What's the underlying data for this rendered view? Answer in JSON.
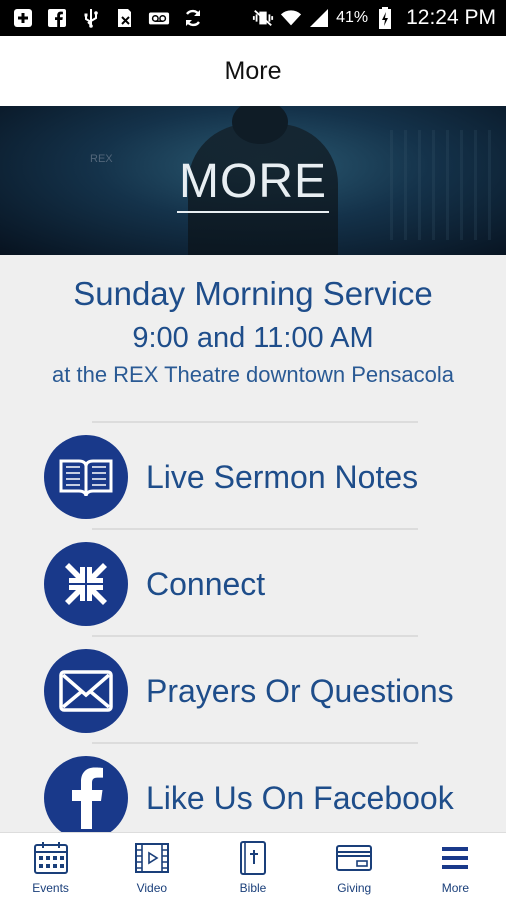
{
  "status_bar": {
    "battery_percent": "41%",
    "time": "12:24 PM",
    "icons": [
      "plus-square-icon",
      "facebook-icon",
      "usb-icon",
      "sd-card-icon",
      "voicemail-icon",
      "sync-icon",
      "mute-vibrate-icon",
      "wifi-icon",
      "signal-icon",
      "battery-charging-icon"
    ]
  },
  "header": {
    "title": "More"
  },
  "hero": {
    "title": "MORE",
    "sign_text": "REX"
  },
  "service": {
    "title": "Sunday Morning Service",
    "time": "9:00 and 11:00 AM",
    "location": "at the REX Theatre downtown Pensacola"
  },
  "menu": {
    "items": [
      {
        "label": "Live Sermon Notes",
        "icon": "open-book-icon"
      },
      {
        "label": "Connect",
        "icon": "arrows-converge-icon"
      },
      {
        "label": "Prayers Or Questions",
        "icon": "envelope-icon"
      },
      {
        "label": "Like Us On Facebook",
        "icon": "facebook-icon"
      }
    ]
  },
  "tab_bar": {
    "tabs": [
      {
        "label": "Events",
        "icon": "calendar-icon"
      },
      {
        "label": "Video",
        "icon": "film-icon"
      },
      {
        "label": "Bible",
        "icon": "bible-icon"
      },
      {
        "label": "Giving",
        "icon": "credit-card-icon"
      },
      {
        "label": "More",
        "icon": "hamburger-menu-icon",
        "active": true
      }
    ]
  },
  "colors": {
    "brand_blue": "#19398a",
    "text_blue": "#1e4d8a",
    "background": "#efefef"
  }
}
